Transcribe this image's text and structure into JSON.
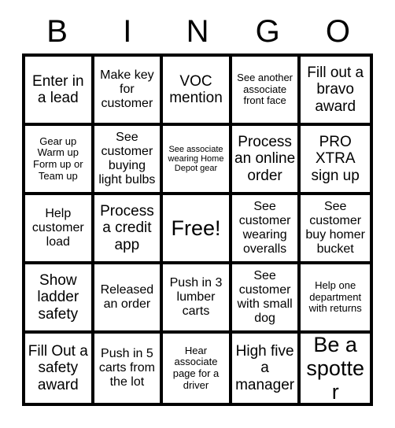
{
  "card": {
    "title": "BINGO",
    "header_letters": [
      "B",
      "I",
      "N",
      "G",
      "O"
    ],
    "colors": {
      "background": "#ffffff",
      "grid_line": "#000000",
      "text": "#000000"
    },
    "grid": {
      "rows": 5,
      "columns": 5,
      "free_space": {
        "row": 3,
        "column": 3,
        "label": "Free!"
      }
    },
    "cells": [
      {
        "id": "b1",
        "column": "B",
        "row": 1,
        "text": "Enter in a lead",
        "size": "lg"
      },
      {
        "id": "i1",
        "column": "I",
        "row": 1,
        "text": "Make key for customer",
        "size": "md"
      },
      {
        "id": "n1",
        "column": "N",
        "row": 1,
        "text": "VOC mention",
        "size": "lg"
      },
      {
        "id": "g1",
        "column": "G",
        "row": 1,
        "text": "See another associate front face",
        "size": "sm"
      },
      {
        "id": "o1",
        "column": "O",
        "row": 1,
        "text": "Fill out a bravo award",
        "size": "lg"
      },
      {
        "id": "b2",
        "column": "B",
        "row": 2,
        "text": "Gear up Warm up Form up or Team up",
        "size": "sm"
      },
      {
        "id": "i2",
        "column": "I",
        "row": 2,
        "text": "See customer buying light bulbs",
        "size": "md"
      },
      {
        "id": "n2",
        "column": "N",
        "row": 2,
        "text": "See associate wearing Home Depot gear",
        "size": "xs"
      },
      {
        "id": "g2",
        "column": "G",
        "row": 2,
        "text": "Process an online order",
        "size": "lg"
      },
      {
        "id": "o2",
        "column": "O",
        "row": 2,
        "text": "PRO XTRA sign up",
        "size": "lg"
      },
      {
        "id": "b3",
        "column": "B",
        "row": 3,
        "text": "Help customer load",
        "size": "md"
      },
      {
        "id": "i3",
        "column": "I",
        "row": 3,
        "text": "Process a credit app",
        "size": "lg"
      },
      {
        "id": "n3",
        "column": "N",
        "row": 3,
        "text": "Free!",
        "size": "xl"
      },
      {
        "id": "g3",
        "column": "G",
        "row": 3,
        "text": "See customer wearing overalls",
        "size": "md"
      },
      {
        "id": "o3",
        "column": "O",
        "row": 3,
        "text": "See customer buy homer bucket",
        "size": "md"
      },
      {
        "id": "b4",
        "column": "B",
        "row": 4,
        "text": "Show ladder safety",
        "size": "lg"
      },
      {
        "id": "i4",
        "column": "I",
        "row": 4,
        "text": "Released an order",
        "size": "md"
      },
      {
        "id": "n4",
        "column": "N",
        "row": 4,
        "text": "Push in 3 lumber carts",
        "size": "md"
      },
      {
        "id": "g4",
        "column": "G",
        "row": 4,
        "text": "See customer with small dog",
        "size": "md"
      },
      {
        "id": "o4",
        "column": "O",
        "row": 4,
        "text": "Help one department with returns",
        "size": "sm"
      },
      {
        "id": "b5",
        "column": "B",
        "row": 5,
        "text": "Fill Out a safety award",
        "size": "lg"
      },
      {
        "id": "i5",
        "column": "I",
        "row": 5,
        "text": "Push in 5 carts from the lot",
        "size": "md"
      },
      {
        "id": "n5",
        "column": "N",
        "row": 5,
        "text": "Hear associate page for a driver",
        "size": "sm"
      },
      {
        "id": "g5",
        "column": "G",
        "row": 5,
        "text": "High five a manager",
        "size": "lg"
      },
      {
        "id": "o5",
        "column": "O",
        "row": 5,
        "text": "Be a spotter",
        "size": "xl"
      }
    ]
  }
}
